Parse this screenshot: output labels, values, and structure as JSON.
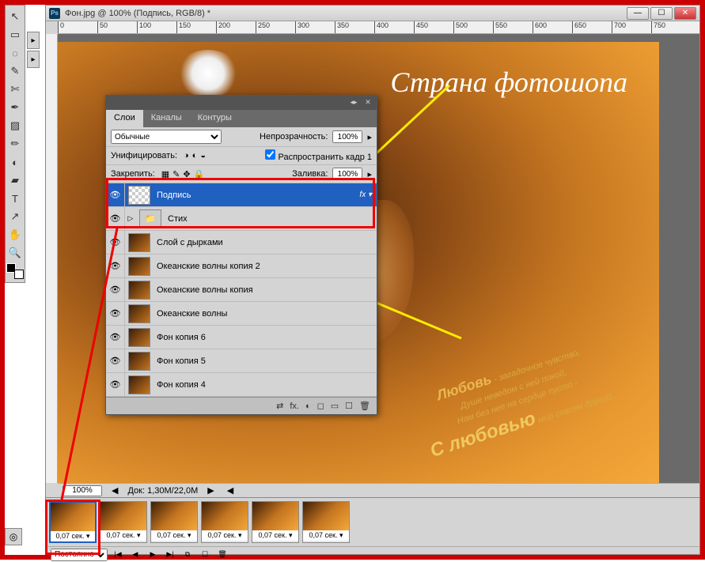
{
  "window": {
    "title": "Фон.jpg @ 100% (Подпись, RGB/8) *",
    "min": "—",
    "max": "☐",
    "close": "✕"
  },
  "ruler": {
    "ticks": [
      "0",
      "50",
      "100",
      "150",
      "200",
      "250",
      "300",
      "350",
      "400",
      "450",
      "500",
      "550",
      "600",
      "650",
      "700",
      "750"
    ]
  },
  "tools": [
    "↖",
    "▭",
    "◌",
    "✎",
    "✄",
    "✒",
    "▨",
    "✏",
    "◐",
    "▰",
    "T",
    "↗",
    "✋",
    "🔍"
  ],
  "canvas": {
    "script_title": "Страна фотошопа",
    "poem_l1a": "Любовь",
    "poem_l1b": " - загадочное чувство,",
    "poem_l2": "Душе неведом с ней покой,",
    "poem_l3": "Нам без нее на сердце пусто -",
    "poem_l4a": "С любовью",
    "poem_l4b": " мир совсем другой..."
  },
  "zoom": {
    "value": "100%",
    "doc": "Док: 1,30M/22,0M"
  },
  "timeline": {
    "frames": [
      "0,07 сек.",
      "0,07 сек.",
      "0,07 сек.",
      "0,07 сек.",
      "0,07 сек.",
      "0,07 сек."
    ],
    "loop": "Постоянно"
  },
  "layers": {
    "tabs": [
      "Слои",
      "Каналы",
      "Контуры"
    ],
    "blend_label": "",
    "blend_mode": "Обычные",
    "opacity_label": "Непрозрачность:",
    "opacity": "100%",
    "unify_label": "Унифицировать:",
    "propagate": "Распространить кадр 1",
    "lock_label": "Закрепить:",
    "fill_label": "Заливка:",
    "fill": "100%",
    "fx": "fx",
    "items": [
      {
        "name": "Подпись",
        "type": "text",
        "fx": true
      },
      {
        "name": "Стих",
        "type": "folder"
      },
      {
        "name": "Слой с дырками",
        "type": "image"
      },
      {
        "name": "Океанские волны копия 2",
        "type": "image"
      },
      {
        "name": "Океанские волны копия",
        "type": "image"
      },
      {
        "name": "Океанские волны",
        "type": "image"
      },
      {
        "name": "Фон копия 6",
        "type": "image"
      },
      {
        "name": "Фон копия 5",
        "type": "image"
      },
      {
        "name": "Фон копия 4",
        "type": "image"
      }
    ],
    "footer_icons": [
      "⇄",
      "fx.",
      "◐",
      "◻",
      "▭",
      "☐",
      "🗑"
    ]
  }
}
